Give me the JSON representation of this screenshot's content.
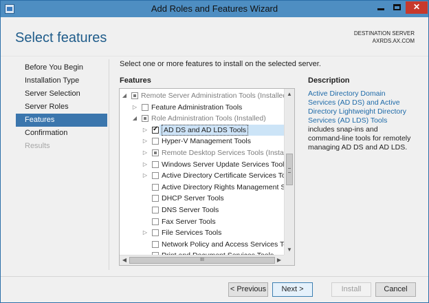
{
  "window": {
    "title": "Add Roles and Features Wizard",
    "accent": "#4e8ec2",
    "close_color": "#c7392c"
  },
  "header": {
    "page_title": "Select features",
    "destination_label": "DESTINATION SERVER",
    "destination_server": "AXRDS.AX.COM"
  },
  "nav": {
    "items": [
      {
        "label": "Before You Begin",
        "state": "normal"
      },
      {
        "label": "Installation Type",
        "state": "normal"
      },
      {
        "label": "Server Selection",
        "state": "normal"
      },
      {
        "label": "Server Roles",
        "state": "normal"
      },
      {
        "label": "Features",
        "state": "active"
      },
      {
        "label": "Confirmation",
        "state": "normal"
      },
      {
        "label": "Results",
        "state": "disabled"
      }
    ]
  },
  "main": {
    "instruction": "Select one or more features to install on the selected server.",
    "features_heading": "Features",
    "tree": [
      {
        "label": "Remote Server Administration Tools (Installed)",
        "expander": "expanded",
        "checkbox": "partial",
        "dim": true
      },
      {
        "label": "Feature Administration Tools",
        "expander": "collapsed",
        "checkbox": "unchecked",
        "dim": false
      },
      {
        "label": "Role Administration Tools (Installed)",
        "expander": "expanded",
        "checkbox": "partial",
        "dim": true
      },
      {
        "label": "AD DS and AD LDS Tools",
        "expander": "collapsed",
        "checkbox": "checked",
        "dim": false,
        "selected": true
      },
      {
        "label": "Hyper-V Management Tools",
        "expander": "collapsed",
        "checkbox": "unchecked",
        "dim": false
      },
      {
        "label": "Remote Desktop Services Tools (Installed)",
        "expander": "collapsed",
        "checkbox": "partial",
        "dim": true
      },
      {
        "label": "Windows Server Update Services Tools",
        "expander": "collapsed",
        "checkbox": "unchecked",
        "dim": false
      },
      {
        "label": "Active Directory Certificate Services Tools",
        "expander": "collapsed",
        "checkbox": "unchecked",
        "dim": false
      },
      {
        "label": "Active Directory Rights Management Servic",
        "expander": "none",
        "checkbox": "unchecked",
        "dim": false
      },
      {
        "label": "DHCP Server Tools",
        "expander": "none",
        "checkbox": "unchecked",
        "dim": false
      },
      {
        "label": "DNS Server Tools",
        "expander": "none",
        "checkbox": "unchecked",
        "dim": false
      },
      {
        "label": "Fax Server Tools",
        "expander": "none",
        "checkbox": "unchecked",
        "dim": false
      },
      {
        "label": "File Services Tools",
        "expander": "collapsed",
        "checkbox": "unchecked",
        "dim": false
      },
      {
        "label": "Network Policy and Access Services Tools",
        "expander": "none",
        "checkbox": "unchecked",
        "dim": false
      },
      {
        "label": "Print and Document Services Tools",
        "expander": "none",
        "checkbox": "unchecked",
        "dim": false
      }
    ],
    "scrollbar_glyph": "III"
  },
  "description": {
    "heading": "Description",
    "link_text": "Active Directory Domain Services (AD DS) and Active Directory Lightweight Directory Services (AD LDS) Tools",
    "body_text": " includes snap-ins and command-line tools for remotely managing AD DS and AD LDS."
  },
  "footer": {
    "previous_label": "< Previous",
    "next_label": "Next >",
    "install_label": "Install",
    "cancel_label": "Cancel"
  }
}
